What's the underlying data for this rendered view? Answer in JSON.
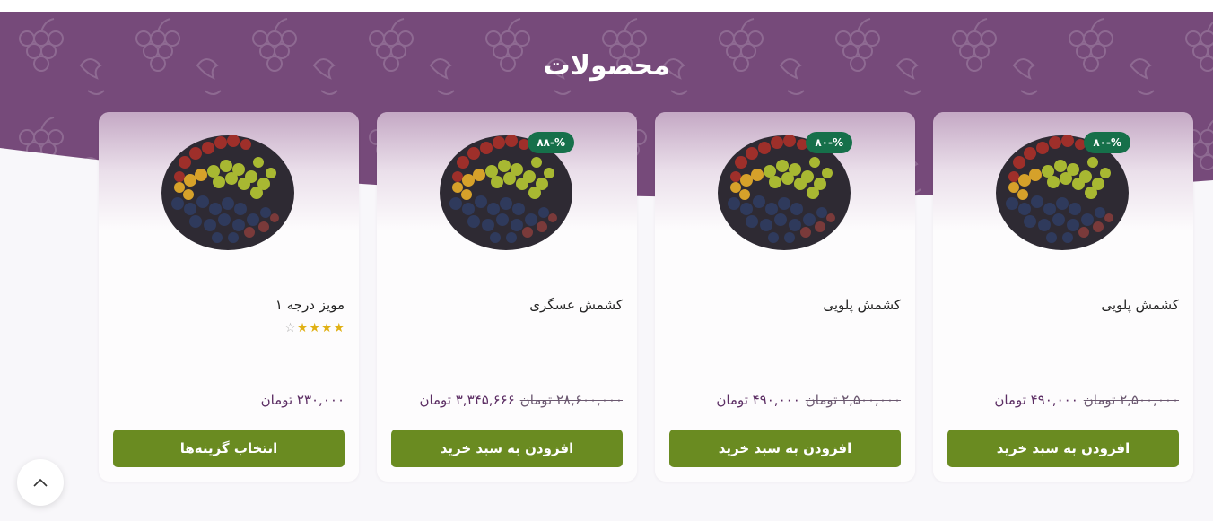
{
  "section": {
    "title": "محصولات"
  },
  "colors": {
    "hero": "#764a7a",
    "badge": "#16704a",
    "button": "#6a8b21",
    "price": "#5b2d63"
  },
  "products": [
    {
      "title": "مویز درجه ۱",
      "badge": "",
      "rating": {
        "filled": 4,
        "total": 5
      },
      "price_old": "",
      "price_new": "۲۳۰,۰۰۰ تومان",
      "button_label": "انتخاب گزینه‌ها"
    },
    {
      "title": "کشمش عسگری",
      "badge": "%-۸۸",
      "rating": null,
      "price_old": "۲۸,۶۰۰,۰۰۰ تومان",
      "price_new": "۳,۳۴۵,۶۶۶ تومان",
      "button_label": "افزودن به سبد خرید"
    },
    {
      "title": "کشمش پلویی",
      "badge": "%-۸۰",
      "rating": null,
      "price_old": "۲,۵۰۰,۰۰۰ تومان",
      "price_new": "۴۹۰,۰۰۰ تومان",
      "button_label": "افزودن به سبد خرید"
    },
    {
      "title": "کشمش پلویی",
      "badge": "%-۸۰",
      "rating": null,
      "price_old": "۲,۵۰۰,۰۰۰ تومان",
      "price_new": "۴۹۰,۰۰۰ تومان",
      "button_label": "افزودن به سبد خرید"
    }
  ],
  "scroll_top": {
    "icon": "chevron-up-icon"
  }
}
